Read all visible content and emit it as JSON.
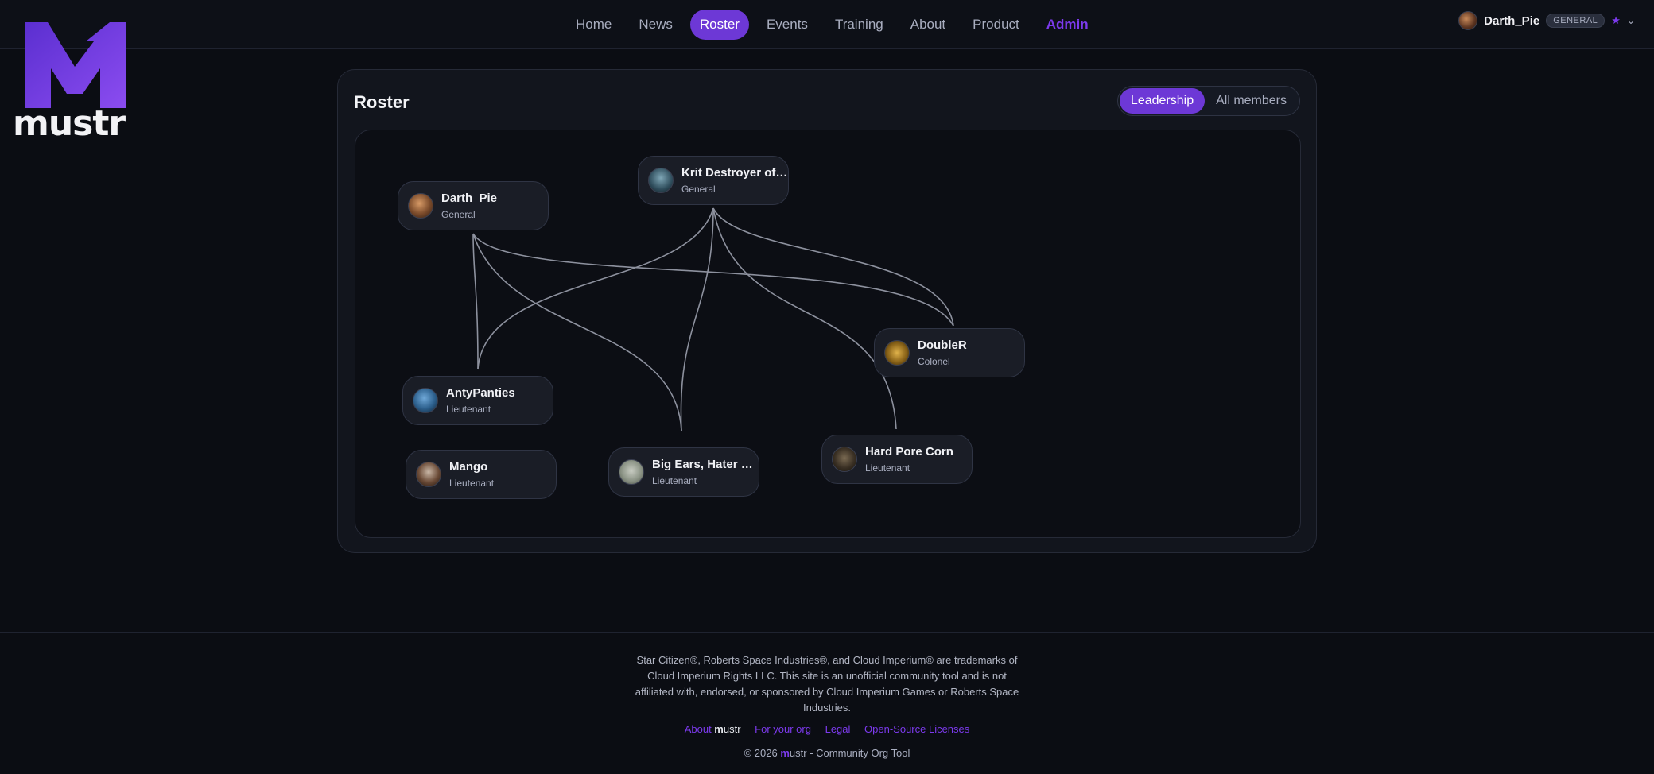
{
  "brand": {
    "logo_text": "mustr",
    "accent": "#6d38d6"
  },
  "nav": {
    "items": [
      {
        "label": "Home"
      },
      {
        "label": "News"
      },
      {
        "label": "Roster"
      },
      {
        "label": "Events"
      },
      {
        "label": "Training"
      },
      {
        "label": "About"
      },
      {
        "label": "Product"
      },
      {
        "label": "Admin"
      }
    ],
    "active": "Roster"
  },
  "user": {
    "name": "Darth_Pie",
    "rank_badge": "GENERAL",
    "star": "★",
    "menu_icon": "chevron-down-icon"
  },
  "roster": {
    "title": "Roster",
    "view_toggle": {
      "leadership": "Leadership",
      "all_members": "All members",
      "selected": "Leadership"
    },
    "members": [
      {
        "name": "Darth_Pie",
        "rank": "General"
      },
      {
        "name": "Krit Destroyer of ...",
        "rank": "General"
      },
      {
        "name": "DoubleR",
        "rank": "Colonel"
      },
      {
        "name": "AntyPanties",
        "rank": "Lieutenant"
      },
      {
        "name": "Mango",
        "rank": "Lieutenant"
      },
      {
        "name": "Big Ears, Hater of...",
        "rank": "Lieutenant"
      },
      {
        "name": "Hard Pore Corn",
        "rank": "Lieutenant"
      }
    ]
  },
  "footer": {
    "disclaimer": "Star Citizen®, Roberts Space Industries®, and Cloud Imperium® are trademarks of Cloud Imperium Rights LLC. This site is an unofficial community tool and is not affiliated with, endorsed, or sponsored by Cloud Imperium Games or Roberts Space Industries.",
    "links": {
      "about_prefix": "About ",
      "about_brand_m": "m",
      "about_brand_rest": "ustr",
      "for_org": "For your org",
      "legal": "Legal",
      "licenses": "Open-Source Licenses"
    },
    "copyright_prefix": "© 2026 ",
    "copyright_brand_m": "m",
    "copyright_rest": "ustr - Community Org Tool"
  }
}
